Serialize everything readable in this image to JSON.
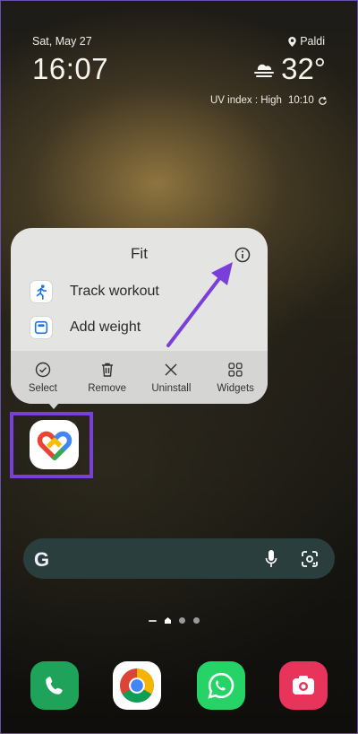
{
  "status": {
    "date": "Sat, May 27",
    "location": "Paldi",
    "time": "16:07",
    "temperature": "32°",
    "uv_index": "UV index : High",
    "updated_time": "10:10"
  },
  "popup": {
    "title": "Fit",
    "shortcuts": [
      {
        "label": "Track workout",
        "icon": "running-person-icon"
      },
      {
        "label": "Add weight",
        "icon": "scale-icon"
      }
    ],
    "actions": [
      {
        "label": "Select",
        "icon": "check-circle-icon"
      },
      {
        "label": "Remove",
        "icon": "trash-icon"
      },
      {
        "label": "Uninstall",
        "icon": "close-icon"
      },
      {
        "label": "Widgets",
        "icon": "widgets-grid-icon"
      }
    ]
  },
  "search": {
    "logo": "G"
  },
  "dock": [
    {
      "app": "Phone",
      "icon": "phone-icon",
      "color": "#1fa35b"
    },
    {
      "app": "Chrome",
      "icon": "chrome-icon",
      "color": "#ffffff"
    },
    {
      "app": "WhatsApp",
      "icon": "whatsapp-icon",
      "color": "#25d366"
    },
    {
      "app": "Camera",
      "icon": "camera-icon",
      "color": "#e8335a"
    }
  ],
  "colors": {
    "highlight": "#7b3fd9",
    "arrow": "#7b3fd9",
    "popup_bg": "#e4e4e2",
    "search_bg": "#2a3f3d"
  }
}
